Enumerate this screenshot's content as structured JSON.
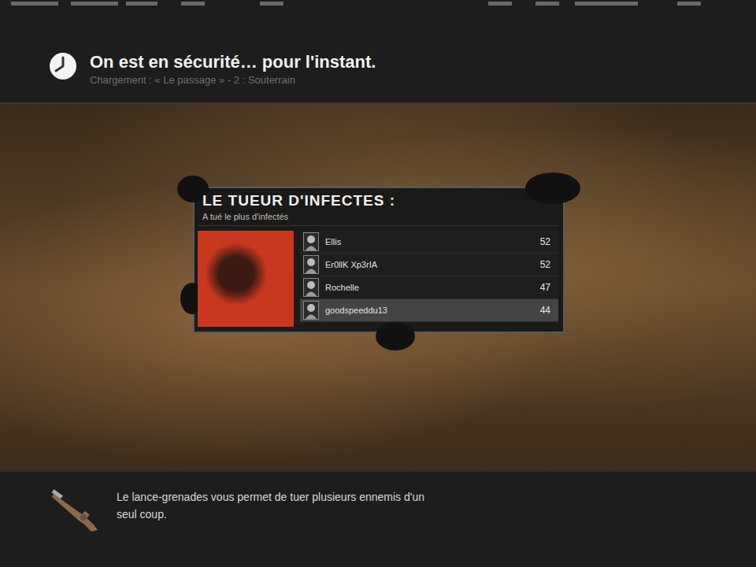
{
  "header": {
    "title": "On est en sécurité… pour l'instant.",
    "subtitle": "Chargement : « Le passage » - 2 : Souterrain"
  },
  "award": {
    "title": "LE TUEUR D'INFECTES :",
    "description": "A tué le plus d'infectés",
    "players": [
      {
        "name": "Ellis",
        "score": "52",
        "selected": false
      },
      {
        "name": "Er0llK Xp3rIA",
        "score": "52",
        "selected": false
      },
      {
        "name": "Rochelle",
        "score": "47",
        "selected": false
      },
      {
        "name": "goodspeeddu13",
        "score": "44",
        "selected": true
      }
    ]
  },
  "tip": {
    "text": "Le lance-grenades vous permet de tuer plusieurs ennemis d'un seul coup."
  }
}
